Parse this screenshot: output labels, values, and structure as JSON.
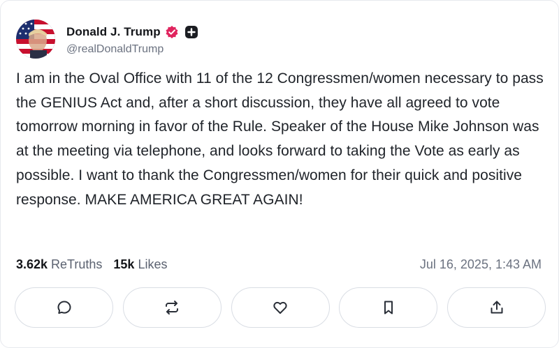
{
  "author": {
    "display_name": "Donald J. Trump",
    "handle": "@realDonaldTrump",
    "avatar_icon": "flag-portrait-avatar",
    "verified_icon": "verified-badge-icon",
    "verified_color": "#e0245e",
    "plus_icon": "plus-badge-icon"
  },
  "post": {
    "text": "I am in the Oval Office with 11 of the 12 Congressmen/women necessary to pass the GENIUS Act and, after a short discussion, they have all agreed to vote tomorrow morning in favor of the Rule. Speaker of the House Mike Johnson was at the meeting via telephone, and looks forward to taking the Vote as early as possible. I want to thank the Congressmen/women for their quick and positive response. MAKE AMERICA GREAT AGAIN!"
  },
  "stats": {
    "retruths_count": "3.62k",
    "retruths_label": "ReTruths",
    "likes_count": "15k",
    "likes_label": "Likes"
  },
  "timestamp": "Jul 16, 2025, 1:43 AM",
  "actions": [
    {
      "name": "reply",
      "icon": "comment-icon"
    },
    {
      "name": "retruth",
      "icon": "repost-icon"
    },
    {
      "name": "like",
      "icon": "heart-icon"
    },
    {
      "name": "bookmark",
      "icon": "bookmark-icon"
    },
    {
      "name": "share",
      "icon": "share-icon"
    }
  ]
}
